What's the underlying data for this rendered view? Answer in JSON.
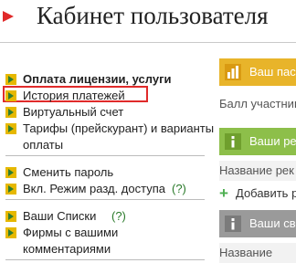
{
  "page": {
    "title": "Кабинет пользователя"
  },
  "menu": {
    "group1": {
      "items": [
        {
          "label": "Оплата лицензии, услуги"
        },
        {
          "label": "История платежей"
        },
        {
          "label": "Виртуальный счет"
        },
        {
          "label": "Тарифы (прейскурант) и варианты"
        },
        {
          "label": "оплаты"
        }
      ]
    },
    "group2": {
      "items": [
        {
          "label": "Сменить пароль"
        },
        {
          "label": "Вкл. Режим разд. доступа"
        },
        {
          "label": "(?)"
        }
      ]
    },
    "group3": {
      "items": [
        {
          "label": "Ваши Списки"
        },
        {
          "label": "(?)"
        },
        {
          "label": "Фирмы с вашими"
        },
        {
          "label": "комментариями"
        }
      ]
    }
  },
  "panels": [
    {
      "header": "Ваш пас",
      "body": "Балл участник",
      "color": "#e8b42a",
      "icon": "bar-chart-icon"
    },
    {
      "header": "Ваши ре",
      "body": "Название рек",
      "action": "Добавить р",
      "color": "#8dbf4a",
      "icon": "info-icon"
    },
    {
      "header": "Ваши св",
      "body": "Название",
      "color": "#9a9a9a",
      "icon": "info-icon"
    }
  ]
}
